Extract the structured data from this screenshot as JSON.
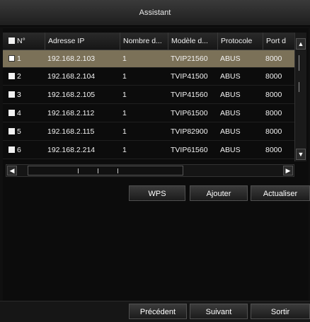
{
  "window": {
    "title": "Assistant"
  },
  "table": {
    "columns": [
      "N°",
      "Adresse IP",
      "Nombre d...",
      "Modèle d...",
      "Protocole",
      "Port d"
    ],
    "rows": [
      {
        "num": "1",
        "ip": "192.168.2.103",
        "count": "1",
        "model": "TVIP21560",
        "protocol": "ABUS",
        "port": "8000"
      },
      {
        "num": "2",
        "ip": "192.168.2.104",
        "count": "1",
        "model": "TVIP41500",
        "protocol": "ABUS",
        "port": "8000"
      },
      {
        "num": "3",
        "ip": "192.168.2.105",
        "count": "1",
        "model": "TVIP41560",
        "protocol": "ABUS",
        "port": "8000"
      },
      {
        "num": "4",
        "ip": "192.168.2.112",
        "count": "1",
        "model": "TVIP61500",
        "protocol": "ABUS",
        "port": "8000"
      },
      {
        "num": "5",
        "ip": "192.168.2.115",
        "count": "1",
        "model": "TVIP82900",
        "protocol": "ABUS",
        "port": "8000"
      },
      {
        "num": "6",
        "ip": "192.168.2.214",
        "count": "1",
        "model": "TVIP61560",
        "protocol": "ABUS",
        "port": "8000"
      }
    ]
  },
  "actions": {
    "wps": "WPS",
    "add": "Ajouter",
    "refresh": "Actualiser"
  },
  "footer": {
    "previous": "Précédent",
    "next": "Suivant",
    "exit": "Sortir"
  },
  "icons": {
    "scroll_up": "chevron-up-icon",
    "scroll_down": "chevron-down-icon",
    "scroll_left": "chevron-left-icon",
    "scroll_right": "chevron-right-icon"
  },
  "colors": {
    "selected_row": "#7b7158",
    "background": "#0c0c0c"
  }
}
